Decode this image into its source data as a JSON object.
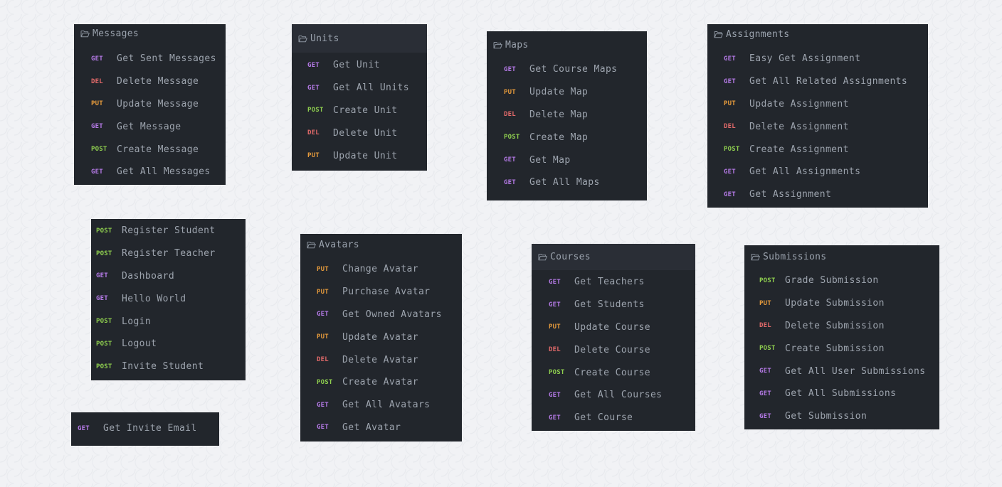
{
  "colors": {
    "background": "#f1f2f5",
    "panel": "#22262c",
    "header_shaded": "#2a2e36",
    "text": "#9da4ae",
    "GET": "#b67be8",
    "POST": "#8fcf4f",
    "PUT": "#e59a3c",
    "DEL": "#e36a6a"
  },
  "icons": {
    "folder": "folder-open-icon"
  },
  "messages": {
    "title": "Messages",
    "items": [
      {
        "method": "GET",
        "label": "Get Sent Messages"
      },
      {
        "method": "DEL",
        "label": "Delete Message"
      },
      {
        "method": "PUT",
        "label": "Update Message"
      },
      {
        "method": "GET",
        "label": "Get Message"
      },
      {
        "method": "POST",
        "label": "Create Message"
      },
      {
        "method": "GET",
        "label": "Get All Messages"
      }
    ]
  },
  "units": {
    "title": "Units",
    "items": [
      {
        "method": "GET",
        "label": "Get Unit"
      },
      {
        "method": "GET",
        "label": "Get All Units"
      },
      {
        "method": "POST",
        "label": "Create Unit"
      },
      {
        "method": "DEL",
        "label": "Delete Unit"
      },
      {
        "method": "PUT",
        "label": "Update Unit"
      }
    ]
  },
  "maps": {
    "title": "Maps",
    "items": [
      {
        "method": "GET",
        "label": "Get Course Maps"
      },
      {
        "method": "PUT",
        "label": "Update Map"
      },
      {
        "method": "DEL",
        "label": "Delete Map"
      },
      {
        "method": "POST",
        "label": "Create Map"
      },
      {
        "method": "GET",
        "label": "Get Map"
      },
      {
        "method": "GET",
        "label": "Get All Maps"
      }
    ]
  },
  "assignments": {
    "title": "Assignments",
    "items": [
      {
        "method": "GET",
        "label": "Easy Get Assignment"
      },
      {
        "method": "GET",
        "label": "Get All Related Assignments"
      },
      {
        "method": "PUT",
        "label": "Update Assignment"
      },
      {
        "method": "DEL",
        "label": "Delete Assignment"
      },
      {
        "method": "POST",
        "label": "Create Assignment"
      },
      {
        "method": "GET",
        "label": "Get All Assignments"
      },
      {
        "method": "GET",
        "label": "Get Assignment"
      }
    ]
  },
  "auth": {
    "items": [
      {
        "method": "POST",
        "label": "Register Student"
      },
      {
        "method": "POST",
        "label": "Register Teacher"
      },
      {
        "method": "GET",
        "label": "Dashboard"
      },
      {
        "method": "GET",
        "label": "Hello World"
      },
      {
        "method": "POST",
        "label": "Login"
      },
      {
        "method": "POST",
        "label": "Logout"
      },
      {
        "method": "POST",
        "label": "Invite Student"
      }
    ]
  },
  "invite": {
    "items": [
      {
        "method": "GET",
        "label": "Get Invite Email"
      }
    ]
  },
  "avatars": {
    "title": "Avatars",
    "items": [
      {
        "method": "PUT",
        "label": "Change Avatar"
      },
      {
        "method": "PUT",
        "label": "Purchase Avatar"
      },
      {
        "method": "GET",
        "label": "Get Owned Avatars"
      },
      {
        "method": "PUT",
        "label": "Update Avatar"
      },
      {
        "method": "DEL",
        "label": "Delete Avatar"
      },
      {
        "method": "POST",
        "label": "Create Avatar"
      },
      {
        "method": "GET",
        "label": "Get All Avatars"
      },
      {
        "method": "GET",
        "label": "Get Avatar"
      }
    ]
  },
  "courses": {
    "title": "Courses",
    "items": [
      {
        "method": "GET",
        "label": "Get Teachers"
      },
      {
        "method": "GET",
        "label": "Get Students"
      },
      {
        "method": "PUT",
        "label": "Update Course"
      },
      {
        "method": "DEL",
        "label": "Delete Course"
      },
      {
        "method": "POST",
        "label": "Create Course"
      },
      {
        "method": "GET",
        "label": "Get All Courses"
      },
      {
        "method": "GET",
        "label": "Get Course"
      }
    ]
  },
  "submissions": {
    "title": "Submissions",
    "items": [
      {
        "method": "POST",
        "label": "Grade Submission"
      },
      {
        "method": "PUT",
        "label": "Update Submission"
      },
      {
        "method": "DEL",
        "label": "Delete Submission"
      },
      {
        "method": "POST",
        "label": "Create Submission"
      },
      {
        "method": "GET",
        "label": "Get All User Submissions"
      },
      {
        "method": "GET",
        "label": "Get All Submissions"
      },
      {
        "method": "GET",
        "label": "Get Submission"
      }
    ]
  }
}
